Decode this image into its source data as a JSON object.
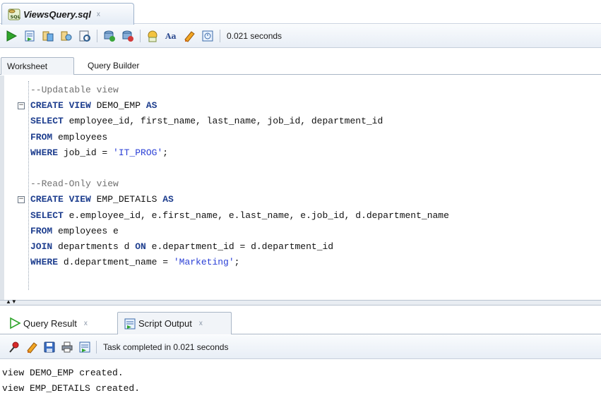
{
  "file_tab": {
    "name": "ViewsQuery.sql",
    "close": "x"
  },
  "toolbar": {
    "icons": [
      "run-statement-icon",
      "run-script-icon",
      "explain-plan-icon",
      "autotrace-icon",
      "sql-tuning-icon",
      "commit-icon",
      "rollback-icon",
      "unshared-sql-icon",
      "to-upper-icon",
      "clear-icon",
      "history-icon"
    ],
    "timing": "0.021 seconds"
  },
  "worksheet_tabs": [
    "Worksheet",
    "Query Builder"
  ],
  "editor": {
    "lines": [
      {
        "fold": false,
        "parts": [
          {
            "t": "cm",
            "v": "--Updatable view"
          }
        ]
      },
      {
        "fold": true,
        "parts": [
          {
            "t": "kw",
            "v": "CREATE VIEW"
          },
          {
            "t": "plain",
            "v": " DEMO_EMP "
          },
          {
            "t": "kw",
            "v": "AS"
          }
        ]
      },
      {
        "fold": false,
        "parts": [
          {
            "t": "kw",
            "v": "SELECT"
          },
          {
            "t": "plain",
            "v": " employee_id, first_name, last_name, job_id, department_id"
          }
        ]
      },
      {
        "fold": false,
        "parts": [
          {
            "t": "kw",
            "v": "FROM"
          },
          {
            "t": "plain",
            "v": " employees"
          }
        ]
      },
      {
        "fold": false,
        "parts": [
          {
            "t": "kw",
            "v": "WHERE"
          },
          {
            "t": "plain",
            "v": " job_id = "
          },
          {
            "t": "str",
            "v": "'IT_PROG'"
          },
          {
            "t": "plain",
            "v": ";"
          }
        ]
      },
      {
        "fold": false,
        "parts": []
      },
      {
        "fold": false,
        "parts": [
          {
            "t": "cm",
            "v": "--Read-Only view"
          }
        ]
      },
      {
        "fold": true,
        "parts": [
          {
            "t": "kw",
            "v": "CREATE VIEW"
          },
          {
            "t": "plain",
            "v": " EMP_DETAILS "
          },
          {
            "t": "kw",
            "v": "AS"
          }
        ]
      },
      {
        "fold": false,
        "parts": [
          {
            "t": "kw",
            "v": "SELECT"
          },
          {
            "t": "plain",
            "v": " e.employee_id, e.first_name, e.last_name, e.job_id, d.department_name"
          }
        ]
      },
      {
        "fold": false,
        "parts": [
          {
            "t": "kw",
            "v": "FROM"
          },
          {
            "t": "plain",
            "v": " employees e"
          }
        ]
      },
      {
        "fold": false,
        "parts": [
          {
            "t": "kw",
            "v": "JOIN"
          },
          {
            "t": "plain",
            "v": " departments d "
          },
          {
            "t": "kw",
            "v": "ON"
          },
          {
            "t": "plain",
            "v": " e.department_id = d.department_id"
          }
        ]
      },
      {
        "fold": false,
        "parts": [
          {
            "t": "kw",
            "v": "WHERE"
          },
          {
            "t": "plain",
            "v": " d.department_name = "
          },
          {
            "t": "str",
            "v": "'Marketing'"
          },
          {
            "t": "plain",
            "v": ";"
          }
        ]
      }
    ]
  },
  "result_tabs": [
    {
      "label": "Query Result",
      "close": "x"
    },
    {
      "label": "Script Output",
      "close": "x"
    }
  ],
  "result_toolbar": {
    "status": "Task completed in 0.021 seconds"
  },
  "output": {
    "lines": [
      "view DEMO_EMP created.",
      "view EMP_DETAILS created."
    ]
  }
}
